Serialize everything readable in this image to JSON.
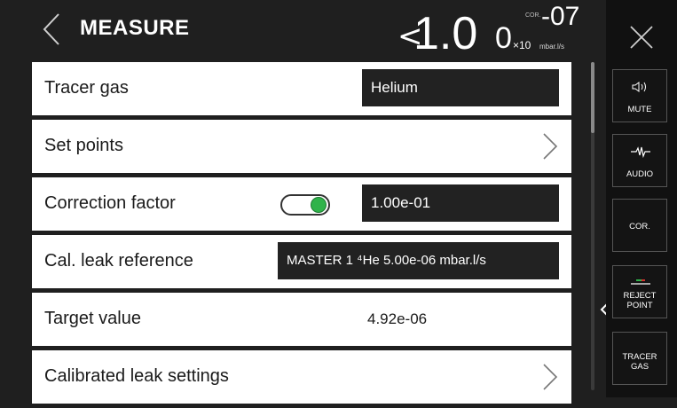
{
  "header": {
    "title": "MEASURE",
    "reading": {
      "prefix": "<",
      "mantissa": "1.0",
      "mantissa_last": "0",
      "cor": "COR.",
      "exponent": "-07",
      "times_ten": "×10",
      "unit": "mbar.l/s"
    }
  },
  "rows": [
    {
      "label": "Tracer gas",
      "value": "Helium"
    },
    {
      "label": "Set points"
    },
    {
      "label": "Correction factor",
      "toggle_on": true,
      "value": "1.00e-01"
    },
    {
      "label": "Cal. leak reference",
      "value": "MASTER 1 ⁴He  5.00e-06 mbar.l/s"
    },
    {
      "label": "Target value",
      "value": "4.92e-06"
    },
    {
      "label": "Calibrated leak settings"
    }
  ],
  "side": {
    "mute": "MUTE",
    "audio": "AUDIO",
    "cor": "COR.",
    "reject_line1": "REJECT",
    "reject_line2": "POINT",
    "tracer_line1": "TRACER",
    "tracer_line2": "GAS"
  },
  "colors": {
    "background": "#1f1f1f",
    "row": "#ffffff",
    "value_box": "#222222",
    "toggle_on": "#2fb34a",
    "reject_green": "#2fb34a",
    "reject_red": "#d32f2f"
  },
  "scroll": {
    "position_fraction": 0.0
  }
}
